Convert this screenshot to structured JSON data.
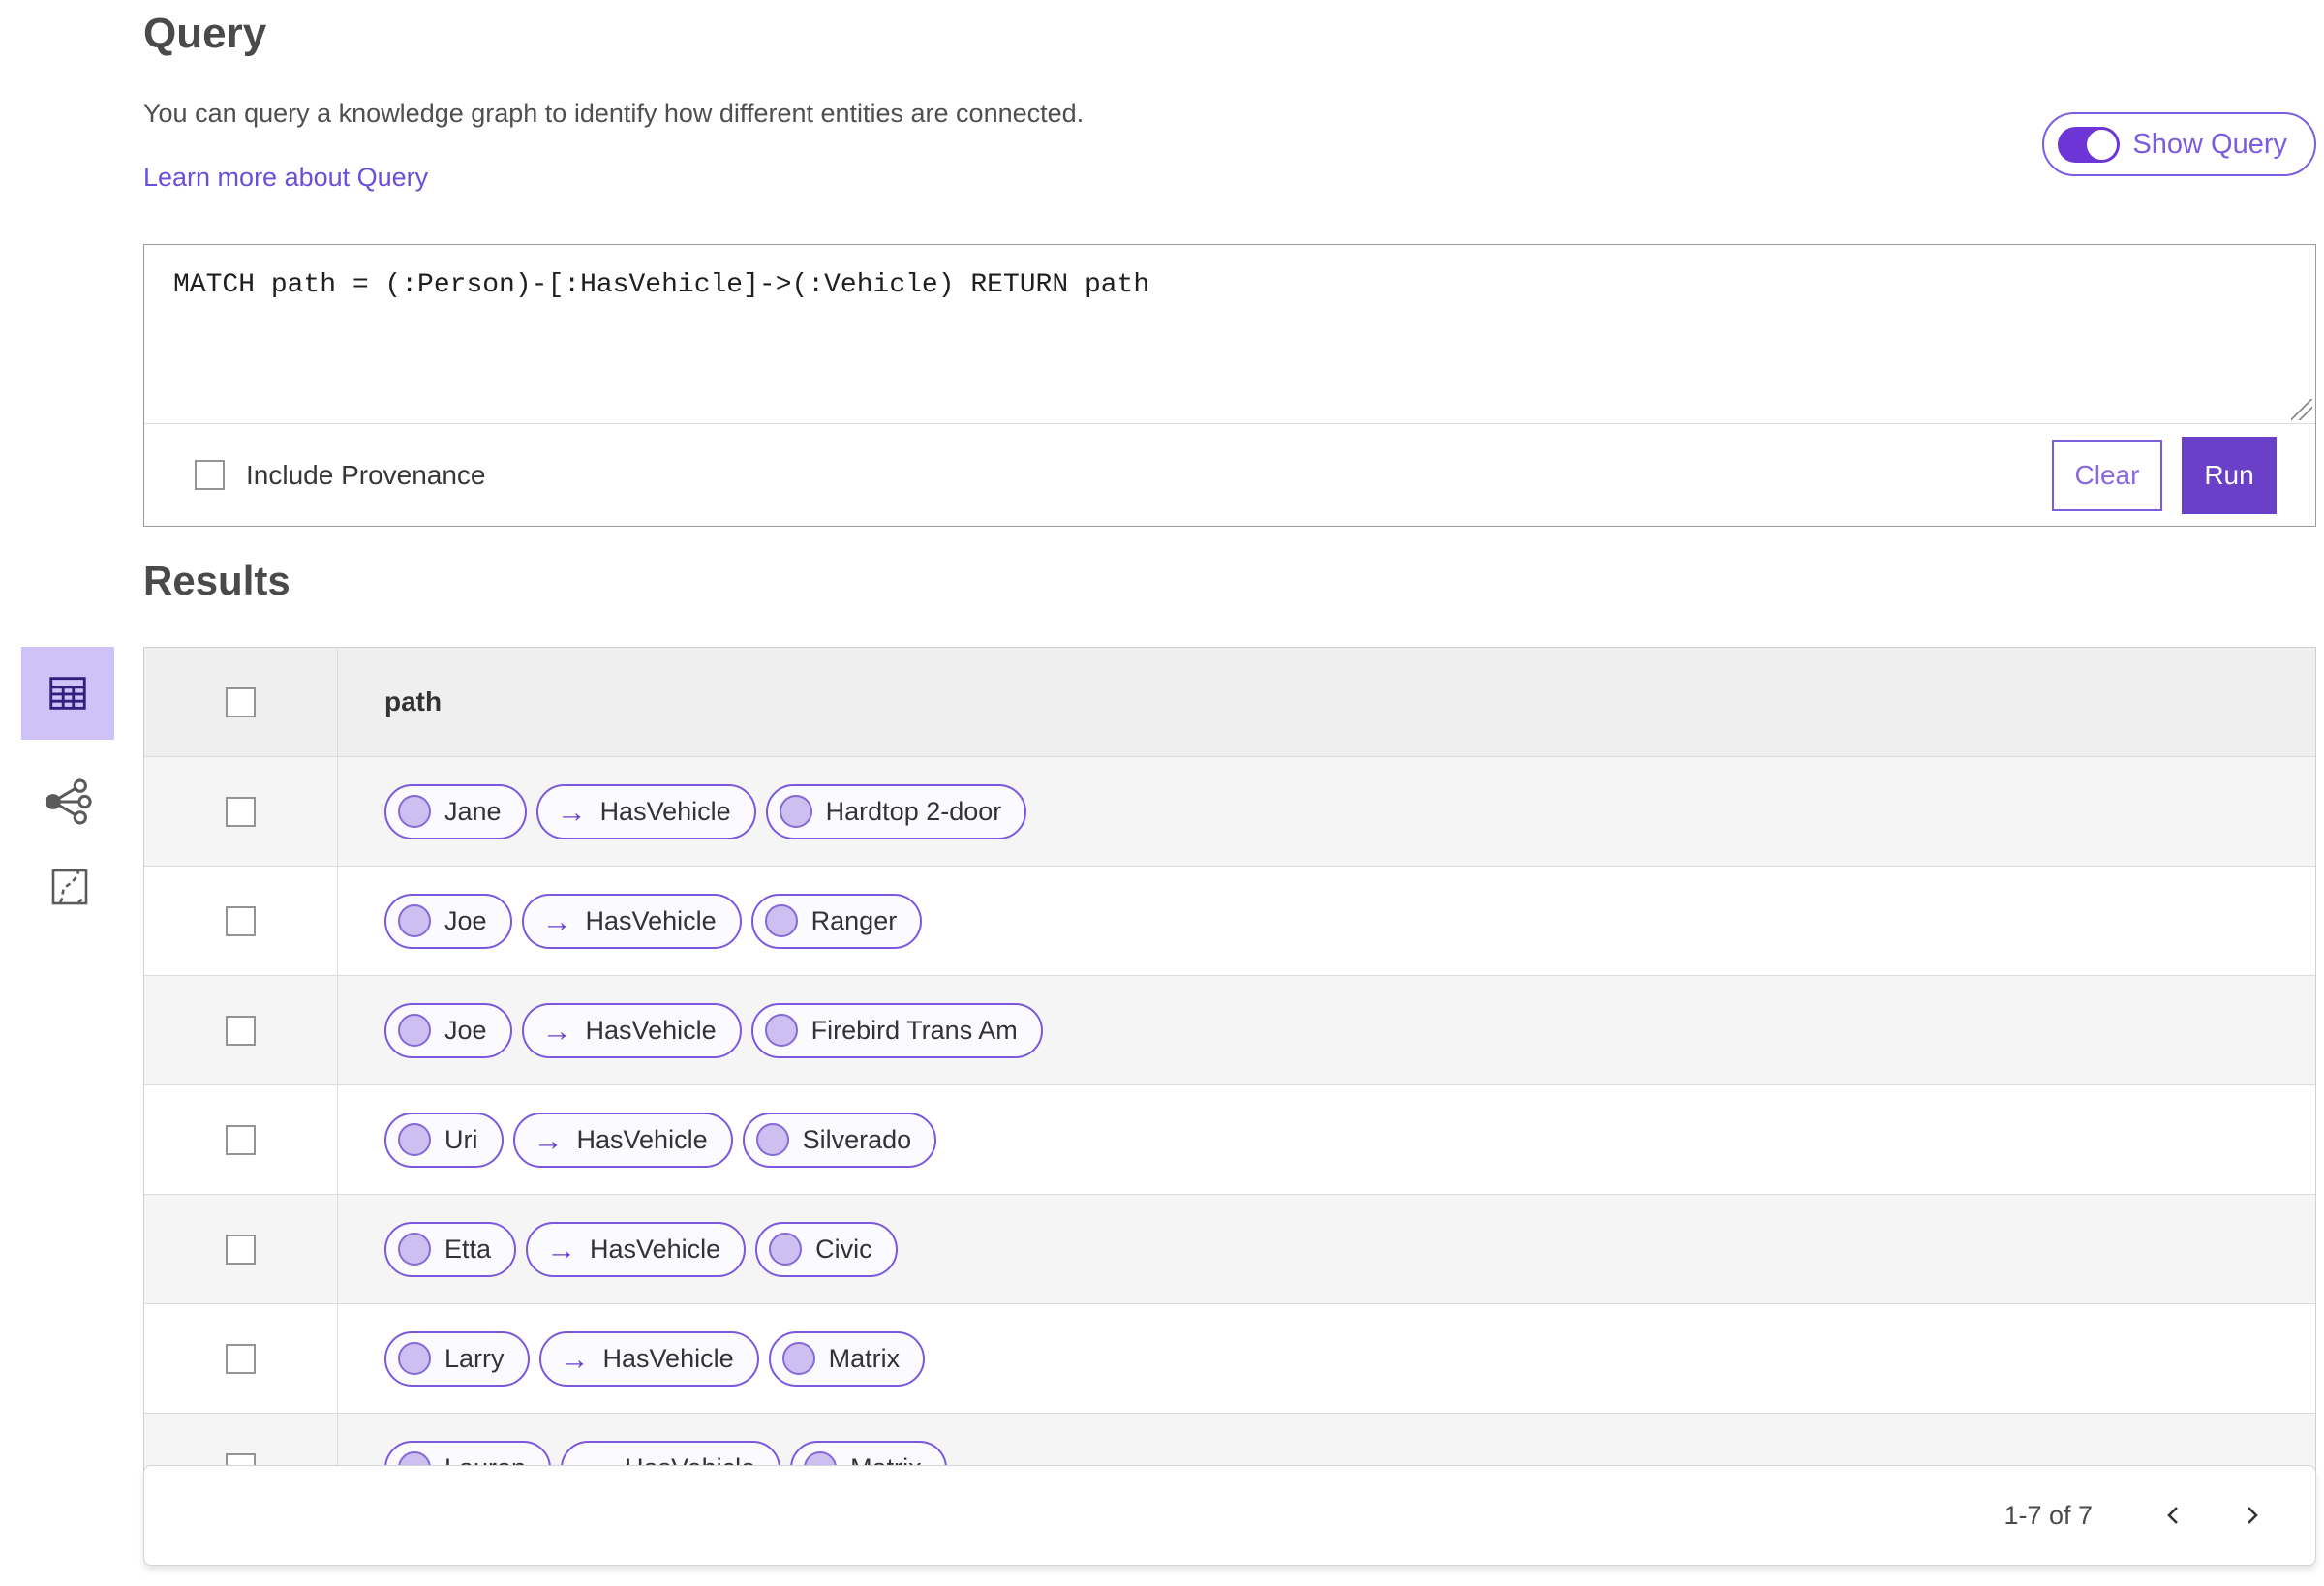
{
  "query_section": {
    "title": "Query",
    "description": "You can query a knowledge graph to identify how different entities are connected.",
    "learn_more": "Learn more about Query",
    "show_query_label": "Show Query",
    "show_query_on": true,
    "query_text": "MATCH path = (:Person)-[:HasVehicle]->(:Vehicle) RETURN path",
    "include_provenance_label": "Include Provenance",
    "include_provenance_checked": false,
    "clear_label": "Clear",
    "run_label": "Run"
  },
  "results_section": {
    "title": "Results",
    "views": [
      {
        "name": "table-view",
        "icon": "table-icon",
        "selected": true
      },
      {
        "name": "link-chart-view",
        "icon": "link-chart-icon",
        "selected": false
      },
      {
        "name": "map-view",
        "icon": "map-icon",
        "selected": false
      }
    ],
    "table": {
      "column_header": "path",
      "rows": [
        {
          "source": "Jane",
          "relationship": "HasVehicle",
          "target": "Hardtop 2-door"
        },
        {
          "source": "Joe",
          "relationship": "HasVehicle",
          "target": "Ranger"
        },
        {
          "source": "Joe",
          "relationship": "HasVehicle",
          "target": "Firebird Trans Am"
        },
        {
          "source": "Uri",
          "relationship": "HasVehicle",
          "target": "Silverado"
        },
        {
          "source": "Etta",
          "relationship": "HasVehicle",
          "target": "Civic"
        },
        {
          "source": "Larry",
          "relationship": "HasVehicle",
          "target": "Matrix"
        },
        {
          "source": "Lauren",
          "relationship": "HasVehicle",
          "target": "Matrix"
        }
      ]
    },
    "pagination": {
      "range_label": "1-7 of 7"
    }
  },
  "icons": {
    "arrow": "→"
  },
  "colors": {
    "accent": "#6a40c8",
    "accent_border": "#7c5ce0",
    "pill_border": "#7b58dd",
    "pill_bg": "#fbfaff",
    "node_fill": "#cdc0f0",
    "node_border": "#8668d9",
    "selected_view_bg": "#cfc2f7",
    "selected_view_icon": "#32207f",
    "link_color": "#6a4fd8",
    "header_row_bg": "#efeff0",
    "alt_row_bg": "#f5f5f6"
  }
}
